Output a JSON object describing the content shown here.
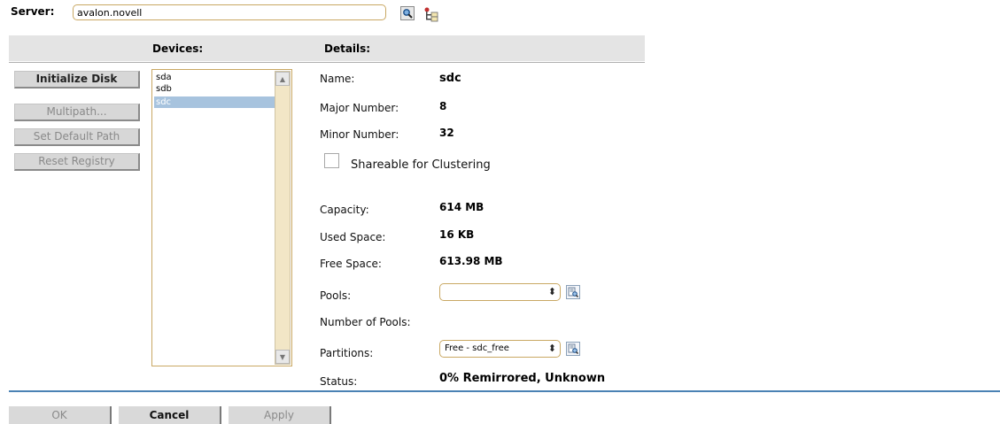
{
  "server": {
    "label": "Server:",
    "value": "avalon.novell"
  },
  "headers": {
    "devices": "Devices:",
    "details": "Details:"
  },
  "actions": {
    "initialize": "Initialize Disk",
    "multipath": "Multipath...",
    "set_default_path": "Set Default Path",
    "reset_registry": "Reset Registry"
  },
  "devices": [
    "sda",
    "sdb",
    "sdc"
  ],
  "selected_device": "sdc",
  "details": {
    "name_label": "Name:",
    "name_value": "sdc",
    "major_label": "Major Number:",
    "major_value": "8",
    "minor_label": "Minor Number:",
    "minor_value": "32",
    "shareable_label": "Shareable for Clustering",
    "capacity_label": "Capacity:",
    "capacity_value": "614 MB",
    "used_label": "Used Space:",
    "used_value": "16 KB",
    "free_label": "Free Space:",
    "free_value": "613.98 MB",
    "pools_label": "Pools:",
    "pools_value": "",
    "num_pools_label": "Number of Pools:",
    "partitions_label": "Partitions:",
    "partitions_value": "Free - sdc_free",
    "status_label": "Status:",
    "status_value": "0% Remirrored, Unknown"
  },
  "bottom": {
    "ok": "OK",
    "cancel": "Cancel",
    "apply": "Apply"
  },
  "icons": {
    "server_search": "magnifier-icon",
    "server_browse": "tree-browse-icon",
    "pools_details": "details-icon",
    "partitions_details": "details-icon"
  },
  "colors": {
    "accent_line": "#4a82b4",
    "selection": "#a7c3de",
    "field_border": "#c9a863"
  }
}
